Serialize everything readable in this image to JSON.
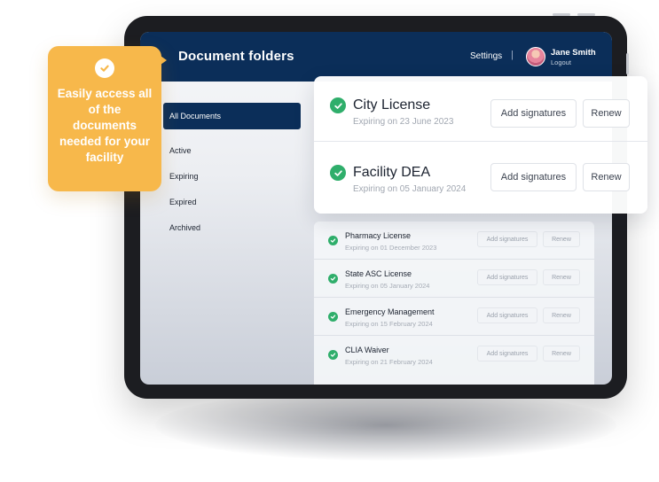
{
  "callout": {
    "text": "Easily access all of the documents needed for your facility",
    "icon": "check-circle-icon",
    "color": "#f7b84b"
  },
  "header": {
    "title": "Document folders",
    "settings_label": "Settings",
    "separator": "|",
    "user_name": "Jane Smith",
    "logout_label": "Logout",
    "background": "#0b2e59"
  },
  "sidebar": {
    "items": [
      {
        "label": "All Documents",
        "active": true
      },
      {
        "label": "Active"
      },
      {
        "label": "Expiring"
      },
      {
        "label": "Expired"
      },
      {
        "label": "Archived"
      }
    ]
  },
  "featured": [
    {
      "name": "City License",
      "expiry": "Expiring on 23 June 2023",
      "sign_label": "Add signatures",
      "renew_label": "Renew"
    },
    {
      "name": "Facility DEA",
      "expiry": "Expiring on 05 January 2024",
      "sign_label": "Add signatures",
      "renew_label": "Renew"
    }
  ],
  "documents": [
    {
      "name": "Pharmacy License",
      "expiry": "Expiring on 01 December 2023",
      "sign_label": "Add signatures",
      "renew_label": "Renew"
    },
    {
      "name": "State ASC License",
      "expiry": "Expiring on 05 January 2024",
      "sign_label": "Add signatures",
      "renew_label": "Renew"
    },
    {
      "name": "Emergency Management",
      "expiry": "Expiring on 15 February 2024",
      "sign_label": "Add signatures",
      "renew_label": "Renew"
    },
    {
      "name": "CLIA Waiver",
      "expiry": "Expiring on 21 February 2024",
      "sign_label": "Add signatures",
      "renew_label": "Renew"
    }
  ],
  "colors": {
    "status_ok": "#2fae6b",
    "accent": "#0b2e59"
  }
}
